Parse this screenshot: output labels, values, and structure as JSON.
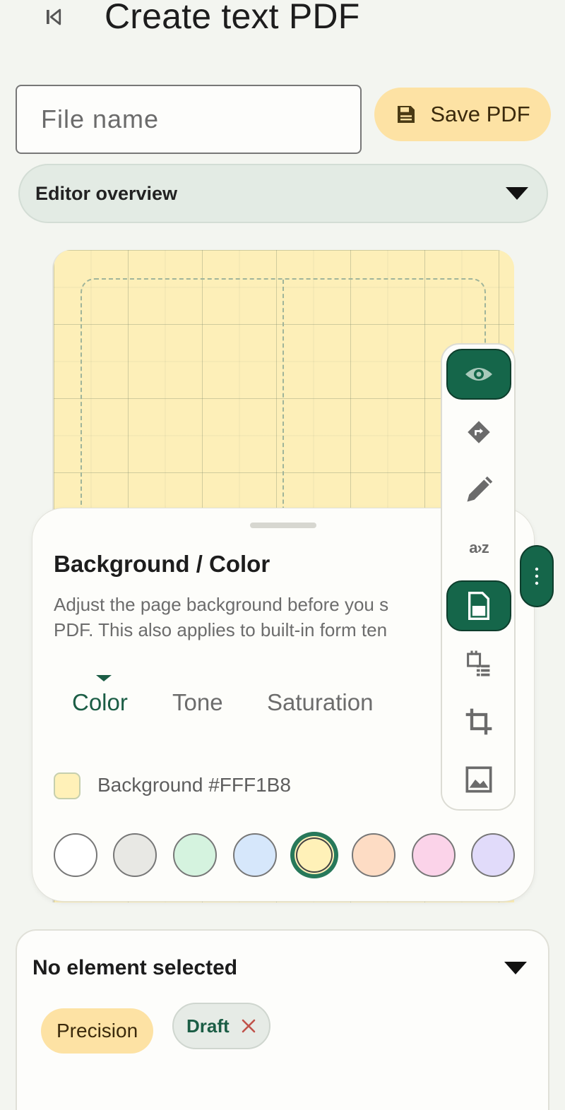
{
  "header": {
    "title": "Create text PDF",
    "back_icon": "first-page-icon"
  },
  "file": {
    "placeholder": "File name",
    "value": ""
  },
  "save_button": {
    "label": "Save PDF",
    "icon": "save-icon"
  },
  "overview": {
    "label": "Editor overview",
    "icon": "dropdown-arrow-icon"
  },
  "sheet": {
    "title": "Background / Color",
    "description_line1": "Adjust the page background before you s",
    "description_line2": "PDF. This also applies to built-in form ten",
    "tabs": [
      {
        "label": "Color",
        "active": true
      },
      {
        "label": "Tone",
        "active": false
      },
      {
        "label": "Saturation",
        "active": false
      }
    ],
    "background_label": "Background #FFF1B8",
    "background_color": "#FFF1B8",
    "swatches": [
      "#FFFFFF",
      "#E8E8E4",
      "#D5F3DF",
      "#D6E7FB",
      "#FFF1B8",
      "#FDDCC4",
      "#FBD3E9",
      "#E1DBFA"
    ],
    "selected_swatch": 4
  },
  "toolbar": {
    "tools": [
      {
        "name": "preview",
        "icon": "eye-icon",
        "active": true
      },
      {
        "name": "direction",
        "icon": "turn-right-icon",
        "active": false
      },
      {
        "name": "draw",
        "icon": "pencil-icon",
        "active": false
      },
      {
        "name": "sort",
        "icon": "a-to-z-icon",
        "active": false
      },
      {
        "name": "page-background",
        "icon": "page-icon",
        "active": true
      },
      {
        "name": "layout",
        "icon": "calendar-list-icon",
        "active": false
      },
      {
        "name": "crop",
        "icon": "crop-icon",
        "active": false
      },
      {
        "name": "image",
        "icon": "image-icon",
        "active": false
      }
    ],
    "sort_glyph": "a›z",
    "more_icon": "more-vertical-icon"
  },
  "element_panel": {
    "title": "No element selected",
    "chips": {
      "precision": "Precision",
      "draft": "Draft"
    }
  },
  "colors": {
    "accent": "#15664A",
    "accent_dark": "#0E3D2C",
    "save_bg": "#FDE2A4",
    "canvas_bg": "#FDEFB8"
  }
}
